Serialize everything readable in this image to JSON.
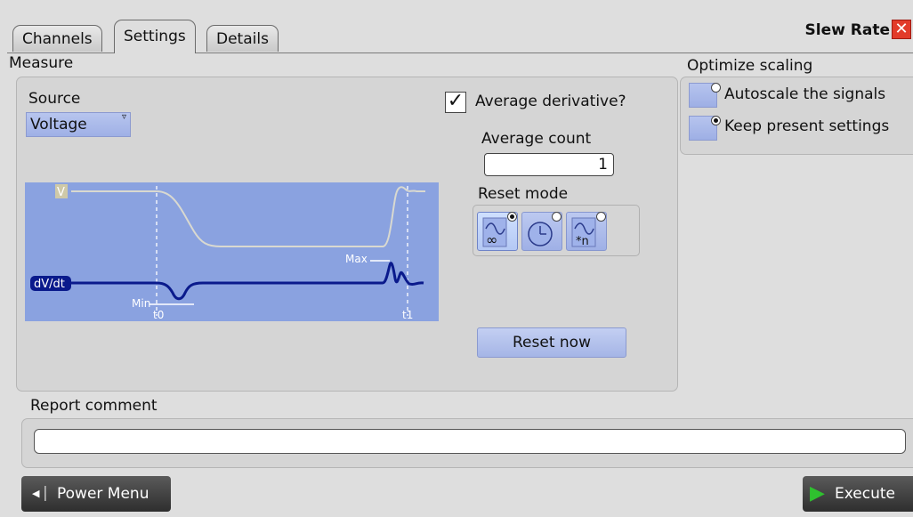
{
  "tabs": [
    {
      "label": "Channels"
    },
    {
      "label": "Settings"
    },
    {
      "label": "Details"
    }
  ],
  "title": "Slew Rate",
  "measure": {
    "label": "Measure",
    "source_label": "Source",
    "source_value": "Voltage",
    "average_derivative_label": "Average derivative?",
    "average_derivative_checked": true,
    "average_count_label": "Average count",
    "average_count_value": "1",
    "reset_mode_label": "Reset mode",
    "reset_mode_icons": [
      "infinity-icon",
      "clock-icon",
      "count-n-icon"
    ],
    "reset_mode_selected": 0,
    "reset_now_label": "Reset now",
    "diagram": {
      "v_label": "V",
      "dvdt_label": "dV/dt",
      "max_label": "Max",
      "min_label": "Min",
      "t0_label": "t0",
      "t1_label": "t1"
    }
  },
  "optimize": {
    "label": "Optimize scaling",
    "options": [
      "Autoscale the signals",
      "Keep present settings"
    ],
    "selected": 1
  },
  "report": {
    "label": "Report comment",
    "value": ""
  },
  "power_menu_label": "Power Menu",
  "execute_label": "Execute",
  "colors": {
    "accent": "#a5b5e6",
    "diagram_bg": "#8aa2e0",
    "diagram_signal": "#0a1a8c",
    "close": "#e23b2a",
    "execute_arrow": "#2fc12f"
  }
}
